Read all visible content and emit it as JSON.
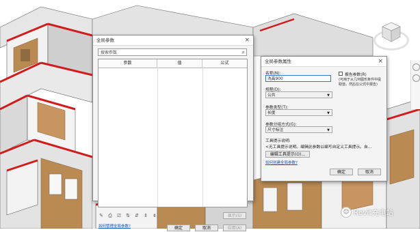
{
  "global_params_dialog": {
    "title": "全局参数",
    "close": "×",
    "search_placeholder": "搜索参数",
    "columns": [
      "参数",
      "值",
      "公式"
    ],
    "tools": [
      "✎",
      "⎙",
      "⎚",
      "⇅",
      "⇵",
      "⇕",
      "⇟"
    ],
    "show_button": "显示(S)",
    "help_link": "如何管理全局参数?",
    "ok": "确定",
    "cancel": "取消",
    "apply": "应用(A)"
  },
  "param_props_dialog": {
    "title": "全局参数属性",
    "close": "×",
    "name_label": "名称(N):",
    "name_value": "洗高900",
    "reporting_label": "报告参数(R)",
    "reporting_note": "(可用于从几何图形条件中提取值，然后在公式中报告)",
    "discipline_label": "规程(D):",
    "discipline_value": "公共",
    "type_label": "参数类型(T):",
    "type_value": "长度",
    "group_label": "参数分组方式(G):",
    "group_value": "尺寸标注",
    "tooltip_label": "工具提示说明:",
    "tooltip_text": "<无工具提示说明。编辑此参数以编写自定义工具提示。自...",
    "edit_tooltip_button": "编辑工具提示(O)...",
    "help_link": "如何创建全局参数?",
    "ok": "确定",
    "cancel": "取消"
  },
  "watermark": {
    "text": "Revit充电站",
    "logo_icon": "wechat-bubble-icon"
  },
  "colors": {
    "wall_red": "#d01c1c",
    "wall_light": "#ececec",
    "wall_mid": "#bdbdbd",
    "wood": "#b98a52",
    "wood_dark": "#8e6b43",
    "link_blue": "#1a4fb8"
  }
}
